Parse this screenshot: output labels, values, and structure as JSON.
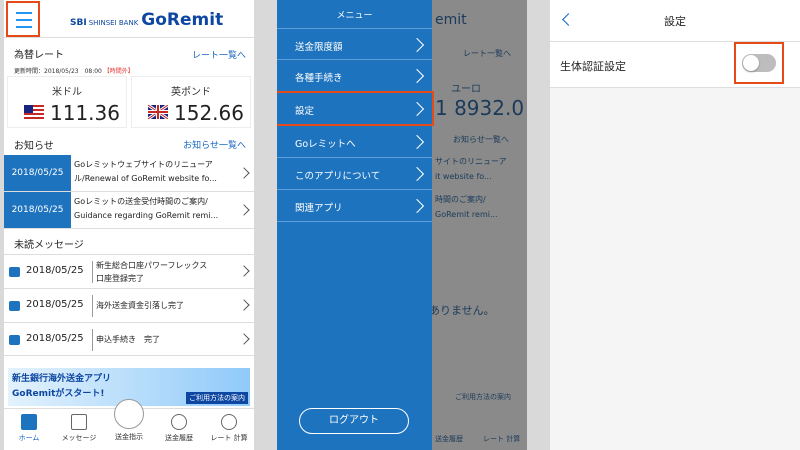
{
  "home": {
    "logo_sbi": "SBI",
    "logo_bank": "SHINSEI BANK",
    "logo_app": "GoRemit",
    "rates": {
      "title": "為替レート",
      "more": "レート一覧へ",
      "updated_label": "更新時間：2018/05/23　08:00",
      "off_hours": "【時間外】",
      "items": [
        {
          "name": "米ドル",
          "value": "111.36",
          "flag": "us-flag-icon"
        },
        {
          "name": "英ポンド",
          "value": "152.66",
          "flag": "uk-flag-icon"
        }
      ]
    },
    "news": {
      "title": "お知らせ",
      "more": "お知らせ一覧へ",
      "items": [
        {
          "date": "2018/05/25",
          "line1": "Goレミットウェブサイトのリニューア",
          "line2": "ル/Renewal of GoRemit website fo..."
        },
        {
          "date": "2018/05/25",
          "line1": "Goレミットの送金受付時間のご案内/",
          "line2": "Guidance regarding GoRemit remi..."
        }
      ]
    },
    "messages": {
      "title": "未読メッセージ",
      "items": [
        {
          "date": "2018/05/25",
          "line1": "新生総合口座パワーフレックス",
          "line2": "口座登録完了"
        },
        {
          "date": "2018/05/25",
          "line1": "海外送金資金引落し完了",
          "line2": ""
        },
        {
          "date": "2018/05/25",
          "line1": "申込手続き　完了",
          "line2": ""
        }
      ]
    },
    "banner": {
      "line1": "新生銀行海外送金アプリ",
      "line2": "GoRemitがスタート!",
      "link": "ご利用方法の案内"
    },
    "tabs": [
      "ホーム",
      "メッセージ",
      "送金指示",
      "送金履歴",
      "レート 計算"
    ]
  },
  "menu": {
    "title": "メニュー",
    "items": [
      "送金限度額",
      "各種手続き",
      "設定",
      "Goレミットへ",
      "このアプリについて",
      "関連アプリ"
    ],
    "logout": "ログアウト",
    "bg": {
      "header": "emit",
      "more": "レート一覧へ",
      "currency": "ユーロ",
      "value": "1 8932.0",
      "news_more": "お知らせ一覧へ",
      "n1a": "サイトのリニューア",
      "n1b": "it website fo...",
      "n2a": "時間のご案内/",
      "n2b": "GoRemit remi...",
      "nomsg": "ありません。",
      "banner": "ご利用方法の案内",
      "tab1": "送金履歴",
      "tab2": "レート 計算"
    }
  },
  "settings": {
    "title": "設定",
    "biometric_label": "生体認証設定",
    "biometric_on": false
  },
  "colors": {
    "accent": "#1e73be",
    "highlight": "#e64a19",
    "link": "#1565c0"
  }
}
